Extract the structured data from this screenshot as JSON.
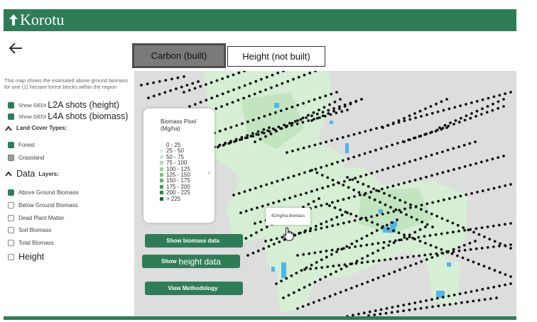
{
  "app": {
    "title": "Korotu",
    "brand_color": "#2e7d57"
  },
  "nav": {
    "back_icon": "arrow-left-icon"
  },
  "tabs": [
    {
      "label": "Carbon (built)",
      "active": true
    },
    {
      "label": "Height (not built)",
      "active": false
    }
  ],
  "sidebar": {
    "description": "This map shows the estimated above ground biomass for one (1) hectare forest blocks within the region",
    "gedi_toggles": [
      {
        "prefix": "Show GEDI",
        "label": "L2A shots (height)",
        "checked": true
      },
      {
        "prefix": "Show GEDI",
        "label": "L4A shots (biomass)",
        "checked": true
      }
    ],
    "land_cover": {
      "title": "Land Cover Types:",
      "items": [
        {
          "label": "Forest",
          "checked": true
        },
        {
          "label": "Grassland",
          "checked": false
        }
      ]
    },
    "data_layers": {
      "title_big": "Data",
      "title_small": "Layers:",
      "items": [
        {
          "label": "Above Ground Biomass",
          "checked": true
        },
        {
          "label": "Below Ground Biomass",
          "checked": false
        },
        {
          "label": "Dead Plant Matter",
          "checked": false
        },
        {
          "label": "Soil Biomass",
          "checked": false
        },
        {
          "label": "Total Biomass",
          "checked": false
        },
        {
          "label": "Height",
          "checked": false
        }
      ]
    }
  },
  "legend": {
    "title_line1": "Biomass Pixel",
    "title_line2": "(Mg/ha)",
    "items": [
      {
        "label": "0 - 25",
        "color": "#f4fbf4"
      },
      {
        "label": "25 - 50",
        "color": "#e4f3e4"
      },
      {
        "label": "50 - 75",
        "color": "#cbe9cb"
      },
      {
        "label": "75 - 100",
        "color": "#b1ddb1"
      },
      {
        "label": "100 - 125",
        "color": "#95d095"
      },
      {
        "label": "125 - 150",
        "color": "#79c279"
      },
      {
        "label": "150 - 175",
        "color": "#5cb35c"
      },
      {
        "label": "175 - 200",
        "color": "#3fa24a"
      },
      {
        "label": "200 - 225",
        "color": "#268a3a"
      },
      {
        "label": "> 225",
        "color": "#116b2a"
      }
    ]
  },
  "buttons": {
    "show_biomass": "Show biomass data",
    "show_height_prefix": "Show",
    "show_height_main": "height data",
    "view_methodology": "View Methodology"
  },
  "map": {
    "tooltip": "42mg/ha biomass",
    "background_color": "#dddddd",
    "vegetation_color": "#d6eed4",
    "water_color": "#4fb6e8"
  }
}
